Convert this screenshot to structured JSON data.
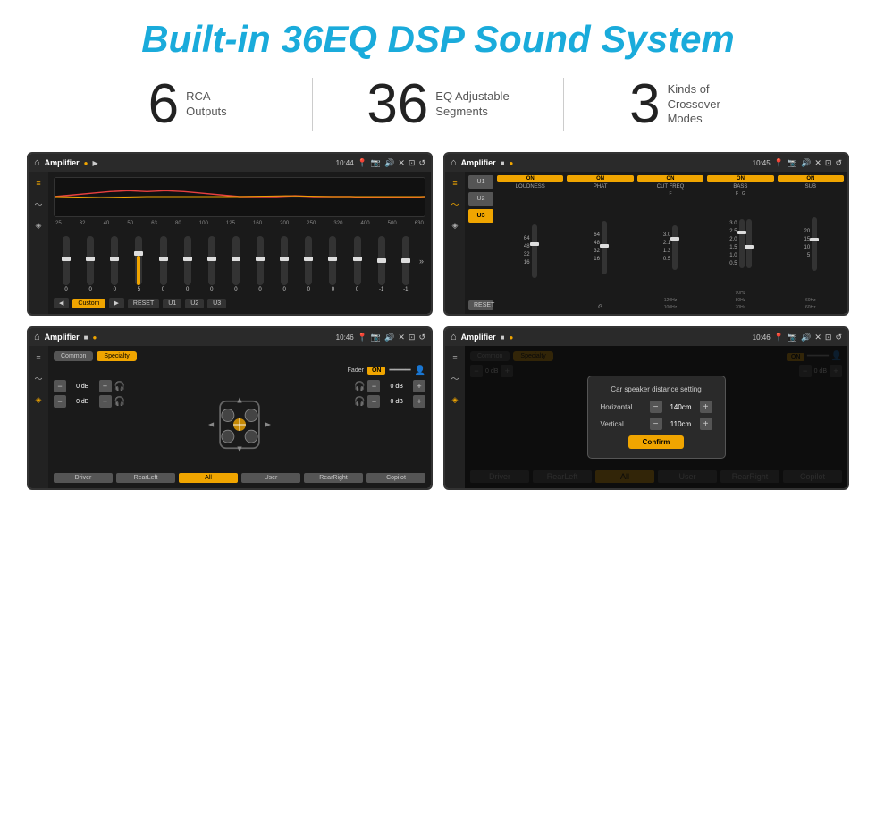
{
  "header": {
    "title": "Built-in 36EQ DSP Sound System"
  },
  "stats": [
    {
      "number": "6",
      "label_line1": "RCA",
      "label_line2": "Outputs"
    },
    {
      "number": "36",
      "label_line1": "EQ Adjustable",
      "label_line2": "Segments"
    },
    {
      "number": "3",
      "label_line1": "Kinds of",
      "label_line2": "Crossover Modes"
    }
  ],
  "screens": [
    {
      "id": "screen1",
      "top_bar": {
        "home": "⌂",
        "title": "Amplifier",
        "time": "10:44"
      },
      "type": "eq",
      "freq_labels": [
        "25",
        "32",
        "40",
        "50",
        "63",
        "80",
        "100",
        "125",
        "160",
        "200",
        "250",
        "320",
        "400",
        "500",
        "630"
      ],
      "slider_values": [
        "0",
        "0",
        "0",
        "5",
        "0",
        "0",
        "0",
        "0",
        "0",
        "0",
        "0",
        "0",
        "0",
        "-1",
        "-1"
      ],
      "bottom_buttons": [
        "◀",
        "Custom",
        "▶",
        "RESET",
        "U1",
        "U2",
        "U3"
      ]
    },
    {
      "id": "screen2",
      "top_bar": {
        "home": "⌂",
        "title": "Amplifier",
        "time": "10:45"
      },
      "type": "crossover",
      "u_buttons": [
        "U1",
        "U2",
        "U3"
      ],
      "active_u": "U3",
      "channels": [
        {
          "label": "LOUDNESS",
          "on": true,
          "vals": [
            "64",
            "48",
            "32",
            "16"
          ]
        },
        {
          "label": "PHAT",
          "on": true,
          "vals": [
            "64",
            "48",
            "32",
            "16"
          ]
        },
        {
          "label": "CUT FREQ",
          "on": true,
          "vals": [
            "3.0",
            "2.1",
            "1.3",
            "0.5"
          ]
        },
        {
          "label": "BASS",
          "on": true,
          "vals": [
            "3.0",
            "2.5",
            "2.0",
            "1.5",
            "1.0",
            "0.5"
          ]
        },
        {
          "label": "SUB",
          "on": true,
          "vals": [
            "20",
            "15",
            "10",
            "5"
          ]
        }
      ],
      "reset_label": "RESET"
    },
    {
      "id": "screen3",
      "top_bar": {
        "home": "⌂",
        "title": "Amplifier",
        "time": "10:46"
      },
      "type": "fader",
      "tabs": [
        "Common",
        "Specialty"
      ],
      "active_tab": "Specialty",
      "fader_label": "Fader",
      "toggle_label": "ON",
      "volumes": [
        {
          "val": "0 dB"
        },
        {
          "val": "0 dB"
        },
        {
          "val": "0 dB"
        },
        {
          "val": "0 dB"
        }
      ],
      "bottom_buttons": [
        "Driver",
        "RearLeft",
        "All",
        "User",
        "RearRight",
        "Copilot"
      ]
    },
    {
      "id": "screen4",
      "top_bar": {
        "home": "⌂",
        "title": "Amplifier",
        "time": "10:46"
      },
      "type": "distance",
      "tabs": [
        "Common",
        "Specialty"
      ],
      "modal": {
        "title": "Car speaker distance setting",
        "horizontal_label": "Horizontal",
        "horizontal_val": "140cm",
        "vertical_label": "Vertical",
        "vertical_val": "110cm",
        "confirm_label": "Confirm"
      },
      "bottom_buttons": [
        "Driver",
        "RearLeft",
        "All",
        "User",
        "RearRight",
        "Copilot"
      ]
    }
  ]
}
